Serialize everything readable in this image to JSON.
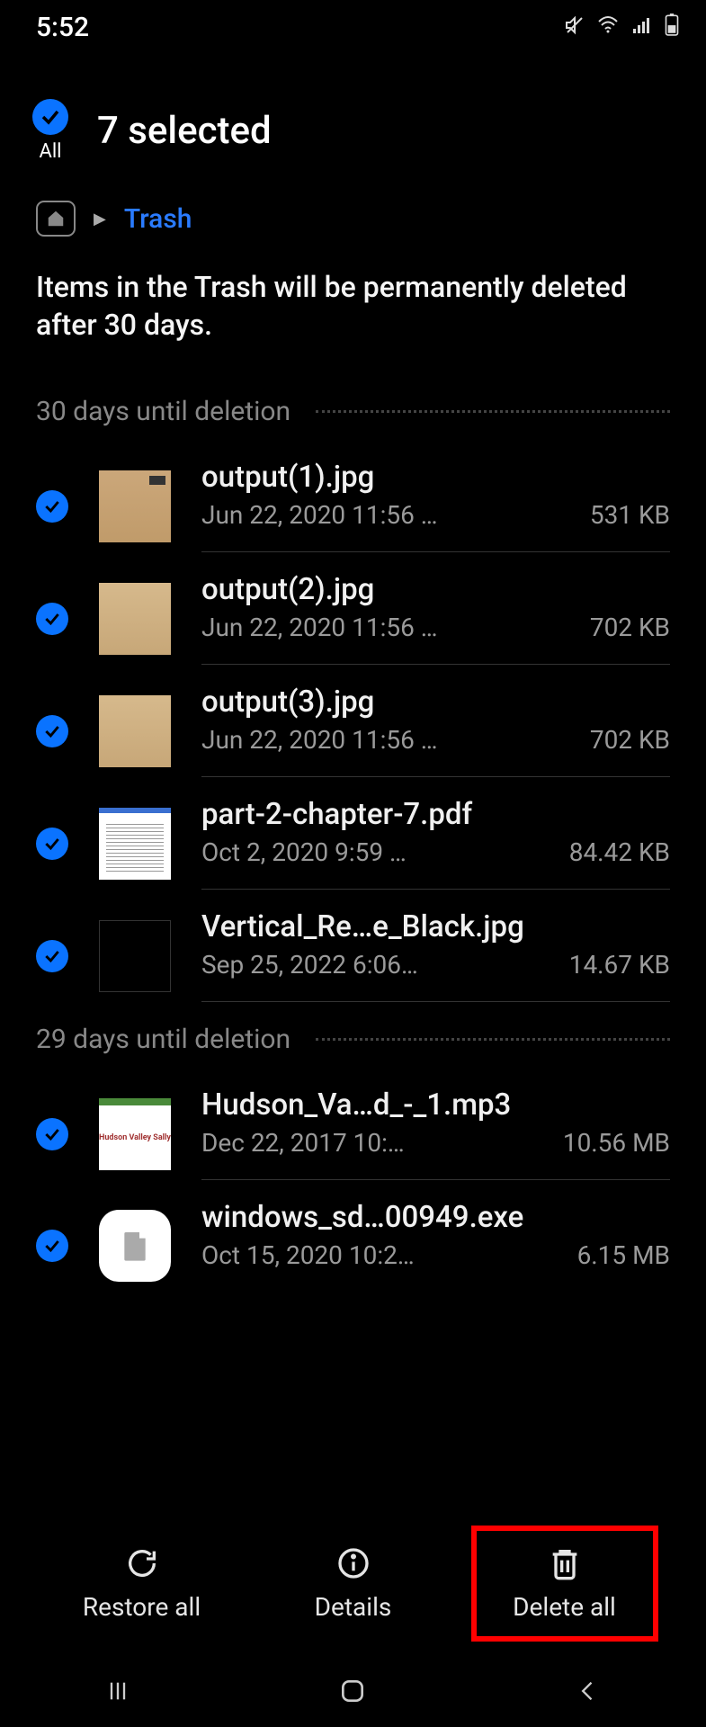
{
  "status": {
    "time": "5:52"
  },
  "header": {
    "all_label": "All",
    "title": "7 selected"
  },
  "breadcrumb": {
    "current": "Trash"
  },
  "notice": "Items in the Trash will be permanently deleted after 30 days.",
  "sections": [
    {
      "label": "30 days until deletion",
      "files": [
        {
          "name": "output(1).jpg",
          "date": "Jun 22, 2020 11:56 …",
          "size": "531 KB",
          "thumb": "doc1"
        },
        {
          "name": "output(2).jpg",
          "date": "Jun 22, 2020 11:56 …",
          "size": "702 KB",
          "thumb": "doc2"
        },
        {
          "name": "output(3).jpg",
          "date": "Jun 22, 2020 11:56 …",
          "size": "702 KB",
          "thumb": "doc2"
        },
        {
          "name": "part-2-chapter-7.pdf",
          "date": "Oct 2, 2020 9:59 …",
          "size": "84.42 KB",
          "thumb": "pdf"
        },
        {
          "name": "Vertical_Re…e_Black.jpg",
          "date": "Sep 25, 2022 6:06…",
          "size": "14.67 KB",
          "thumb": "blank"
        }
      ]
    },
    {
      "label": "29 days until deletion",
      "files": [
        {
          "name": "Hudson_Va…d_-_1.mp3",
          "date": "Dec 22, 2017 10:…",
          "size": "10.56 MB",
          "thumb": "album"
        },
        {
          "name": "windows_sd…00949.exe",
          "date": "Oct 15, 2020 10:2…",
          "size": "6.15 MB",
          "thumb": "exe"
        }
      ]
    }
  ],
  "actions": {
    "restore": "Restore all",
    "details": "Details",
    "delete": "Delete all"
  }
}
